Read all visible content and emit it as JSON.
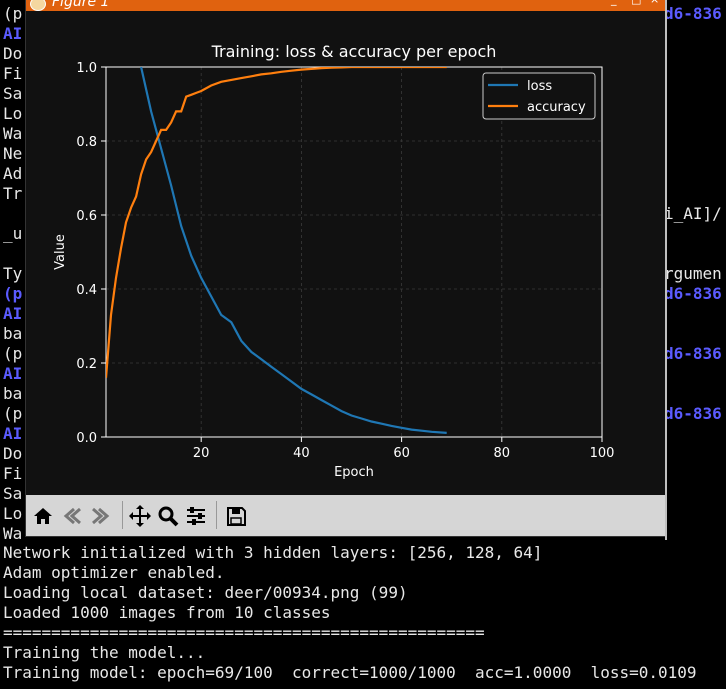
{
  "window": {
    "title": "Figure 1"
  },
  "terminal": {
    "left_fragments": [
      "(p",
      "AI",
      "Do",
      "Fi",
      "Sa",
      "Lo",
      "Wa",
      "Ne",
      "Ad",
      "Tr",
      "",
      "_u",
      "",
      "Ty",
      "(p",
      "AI",
      "ba",
      "(p",
      "AI",
      "ba",
      "(p",
      "AI",
      "Do",
      "Fi",
      "Sa",
      "Lo",
      "Wa"
    ],
    "right_fragments": {
      "r0": "d6-836",
      "r1": "i_AI]/",
      "r2": "rgumen",
      "r3": "d6-836",
      "r4": "d6-836",
      "r5": "d6-836"
    },
    "bottom_lines": [
      "Network initialized with 3 hidden layers: [256, 128, 64]",
      "Adam optimizer enabled.",
      "Loading local dataset: deer/00934.png (99)",
      "Loaded 1000 images from 10 classes",
      "==================================================",
      "Training the model...",
      "Training model: epoch=69/100  correct=1000/1000  acc=1.0000  loss=0.0109"
    ]
  },
  "toolbar": {
    "buttons": [
      "home-icon",
      "back-icon",
      "forward-icon",
      "pan-icon",
      "zoom-icon",
      "configure-icon",
      "save-icon"
    ]
  },
  "chart_data": {
    "type": "line",
    "title": "Training: loss & accuracy per epoch",
    "xlabel": "Epoch",
    "ylabel": "Value",
    "xlim": [
      1,
      100
    ],
    "ylim": [
      0,
      1.0
    ],
    "xticks": [
      "20",
      "40",
      "60",
      "80",
      "100"
    ],
    "yticks": [
      "0.0",
      "0.2",
      "0.4",
      "0.6",
      "0.8",
      "1.0"
    ],
    "grid": true,
    "legend": "top-right",
    "series": [
      {
        "name": "loss",
        "color": "#1f77b4",
        "x": [
          8,
          10,
          12,
          14,
          16,
          18,
          20,
          22,
          24,
          26,
          28,
          30,
          32,
          34,
          36,
          38,
          40,
          42,
          44,
          46,
          48,
          50,
          52,
          54,
          56,
          58,
          60,
          62,
          64,
          66,
          69
        ],
        "y": [
          1.0,
          0.88,
          0.78,
          0.68,
          0.57,
          0.49,
          0.43,
          0.38,
          0.33,
          0.31,
          0.26,
          0.23,
          0.21,
          0.19,
          0.17,
          0.15,
          0.13,
          0.115,
          0.1,
          0.085,
          0.07,
          0.058,
          0.05,
          0.042,
          0.036,
          0.03,
          0.025,
          0.02,
          0.017,
          0.014,
          0.011
        ]
      },
      {
        "name": "accuracy",
        "color": "#ff7f0e",
        "x": [
          1,
          2,
          3,
          4,
          5,
          6,
          7,
          8,
          9,
          10,
          11,
          12,
          13,
          14,
          15,
          16,
          17,
          18,
          19,
          20,
          22,
          24,
          26,
          28,
          30,
          32,
          34,
          36,
          38,
          40,
          42,
          44,
          46,
          48,
          50,
          52,
          54,
          56,
          58,
          60,
          62,
          64,
          66,
          69
        ],
        "y": [
          0.16,
          0.33,
          0.43,
          0.51,
          0.58,
          0.62,
          0.65,
          0.71,
          0.75,
          0.77,
          0.8,
          0.83,
          0.83,
          0.85,
          0.88,
          0.88,
          0.92,
          0.925,
          0.93,
          0.935,
          0.95,
          0.96,
          0.965,
          0.97,
          0.975,
          0.98,
          0.983,
          0.987,
          0.99,
          0.993,
          0.995,
          0.997,
          0.998,
          0.999,
          1.0,
          1.0,
          1.0,
          1.0,
          1.0,
          1.0,
          1.0,
          1.0,
          1.0,
          1.0
        ]
      }
    ]
  }
}
